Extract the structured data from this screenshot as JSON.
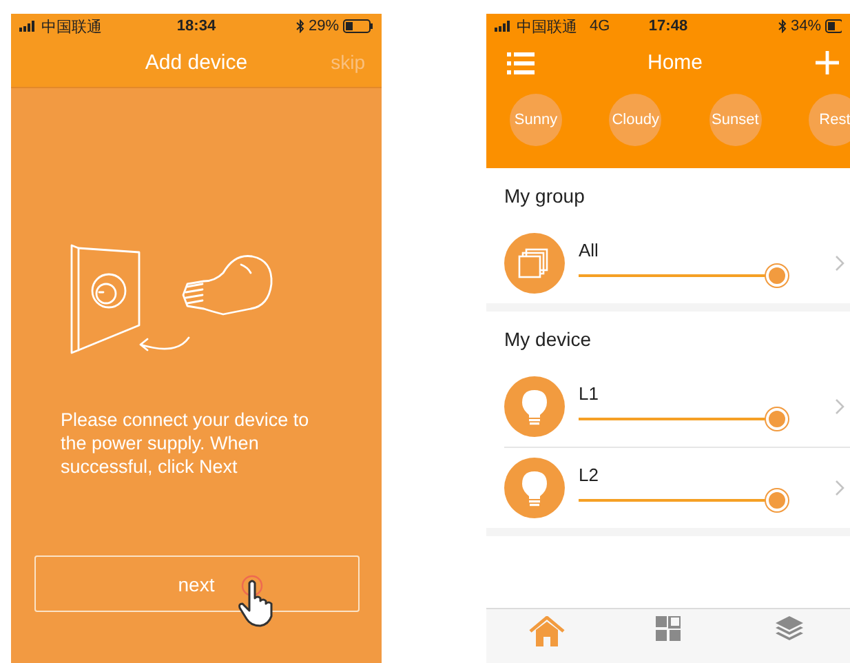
{
  "add_device_screen": {
    "status_bar": {
      "carrier": "中国联通",
      "time": "18:34",
      "battery": "29%"
    },
    "title": "Add device",
    "skip": {
      "label": "skip",
      "disabled": true
    },
    "instructions": "Please connect your device to the power supply. When successful, click Next",
    "button": "next"
  },
  "home_screen": {
    "status_bar": {
      "carrier": "中国联通",
      "network": "4G",
      "time": "17:48",
      "battery": "34%"
    },
    "title": "Home",
    "scenes": [
      "Sunny",
      "Cloudy",
      "Sunset",
      "Rest"
    ],
    "sections": [
      {
        "title": "My group",
        "items": [
          {
            "name": "All",
            "kind": "group",
            "level": 0.95
          }
        ]
      },
      {
        "title": "My device",
        "items": [
          {
            "name": "L1",
            "kind": "bulb",
            "level": 0.95
          },
          {
            "name": "L2",
            "kind": "bulb",
            "level": 0.95
          }
        ]
      }
    ],
    "tab_bar": [
      {
        "kind": "home",
        "selected": true
      },
      {
        "kind": "scene",
        "selected": false
      },
      {
        "kind": "group",
        "selected": false
      }
    ]
  }
}
